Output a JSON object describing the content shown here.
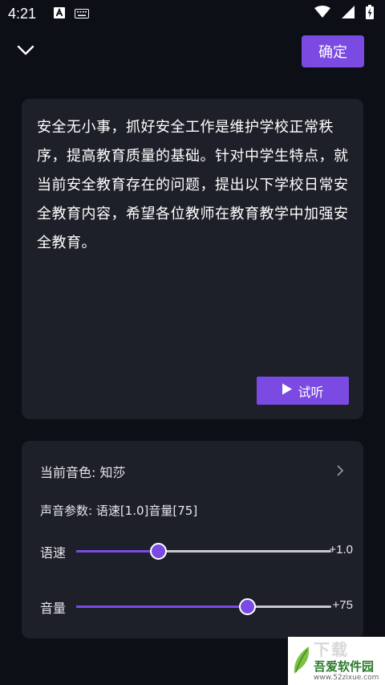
{
  "status_bar": {
    "time": "4:21"
  },
  "header": {
    "confirm_label": "确定"
  },
  "text_card": {
    "content": "安全无小事，抓好安全工作是维护学校正常秩序，提高教育质量的基础。针对中学生特点，就当前安全教育存在的问题，提出以下学校日常安全教育内容，希望各位教师在教育教学中加强安全教育。",
    "preview_label": "试听"
  },
  "settings": {
    "current_voice_label": "当前音色: 知莎",
    "params_text": "声音参数: 语速[1.0]音量[75]",
    "speed": {
      "label": "语速",
      "value_text": "+1.0",
      "fraction": 0.32
    },
    "volume": {
      "label": "音量",
      "value_text": "+75",
      "fraction": 0.67
    }
  },
  "colors": {
    "accent": "#7b4ae2",
    "background": "#0d0f17",
    "card": "#1e2029"
  },
  "watermark": {
    "top_text": "下载",
    "name": "吾爱软件园",
    "url": "www.52zixue.com"
  }
}
